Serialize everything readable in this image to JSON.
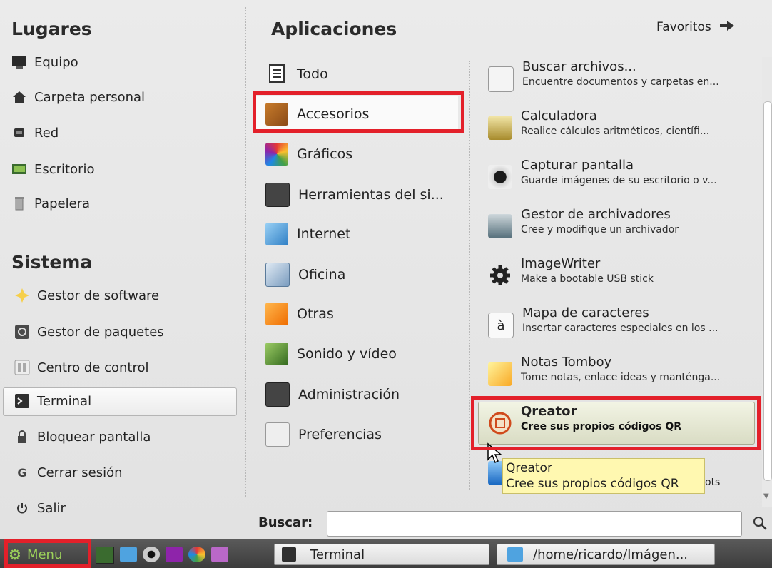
{
  "places": {
    "heading": "Lugares",
    "items": [
      {
        "label": "Equipo",
        "icon": "computer-icon"
      },
      {
        "label": "Carpeta personal",
        "icon": "home-icon"
      },
      {
        "label": "Red",
        "icon": "network-icon"
      },
      {
        "label": "Escritorio",
        "icon": "desktop-icon"
      },
      {
        "label": "Papelera",
        "icon": "trash-icon"
      }
    ]
  },
  "system": {
    "heading": "Sistema",
    "items": [
      {
        "label": "Gestor de software",
        "icon": "software-manager-icon"
      },
      {
        "label": "Gestor de paquetes",
        "icon": "package-manager-icon"
      },
      {
        "label": "Centro de control",
        "icon": "control-center-icon"
      },
      {
        "label": "Terminal",
        "icon": "terminal-icon"
      },
      {
        "label": "Bloquear pantalla",
        "icon": "lock-icon"
      },
      {
        "label": "Cerrar sesión",
        "icon": "logout-icon"
      },
      {
        "label": "Salir",
        "icon": "power-icon"
      }
    ]
  },
  "applications": {
    "heading": "Aplicaciones",
    "favorites_label": "Favoritos",
    "categories": [
      "Todo",
      "Accesorios",
      "Gráficos",
      "Herramientas del si...",
      "Internet",
      "Oficina",
      "Otras",
      "Sonido y vídeo",
      "Administración",
      "Preferencias"
    ],
    "apps": [
      {
        "title": "Buscar archivos...",
        "desc": "Encuentre documentos y carpetas en..."
      },
      {
        "title": "Calculadora",
        "desc": "Realice cálculos aritméticos, científi..."
      },
      {
        "title": "Capturar pantalla",
        "desc": "Guarde imágenes de su escritorio o v..."
      },
      {
        "title": "Gestor de archivadores",
        "desc": "Cree y modifique un archivador"
      },
      {
        "title": "ImageWriter",
        "desc": "Make a bootable USB stick"
      },
      {
        "title": "Mapa de caracteres",
        "desc": "Insertar caracteres especiales en los ..."
      },
      {
        "title": "Notas Tomboy",
        "desc": "Tome notas, enlace ideas y manténga..."
      },
      {
        "title": "Qreator",
        "desc": "Cree sus propios códigos QR"
      }
    ],
    "hidden_partial": "ots"
  },
  "tooltip": {
    "title": "Qreator",
    "desc": "Cree sus propios códigos QR"
  },
  "search": {
    "label": "Buscar:",
    "value": ""
  },
  "taskbar": {
    "menu_label": "Menu",
    "windows": [
      "Terminal",
      "/home/ricardo/Imágen..."
    ]
  },
  "colors": {
    "highlight": "#e3202a",
    "menu_accent": "#8fbf45"
  }
}
